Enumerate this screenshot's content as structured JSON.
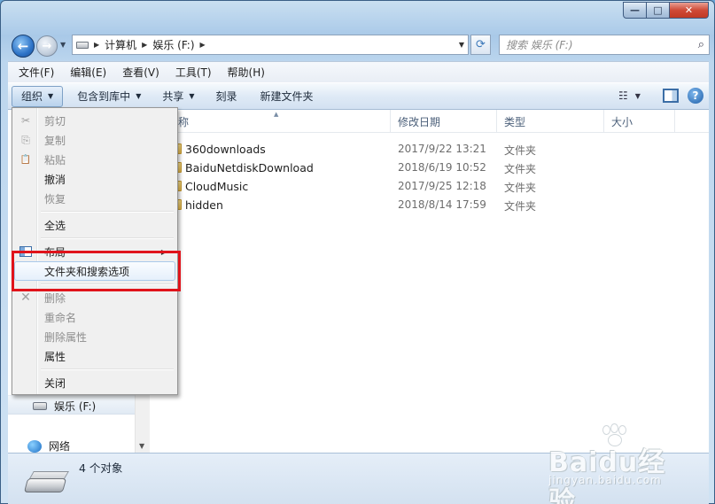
{
  "window": {
    "controls": {
      "minimize": "—",
      "maximize": "□",
      "close": "✕"
    }
  },
  "nav": {
    "back_glyph": "←",
    "forward_glyph": "→",
    "history_glyph": "▼",
    "refresh_glyph": "⟳"
  },
  "address": {
    "crumbs": [
      "计算机",
      "娱乐 (F:)"
    ],
    "separator": "▶",
    "dropdown_glyph": "▼"
  },
  "search": {
    "placeholder": "搜索 娱乐 (F:)",
    "icon_glyph": "⌕"
  },
  "menubar": {
    "items": [
      "文件(F)",
      "编辑(E)",
      "查看(V)",
      "工具(T)",
      "帮助(H)"
    ]
  },
  "toolbar": {
    "organize": "组织",
    "include_library": "包含到库中",
    "share": "共享",
    "burn": "刻录",
    "new_folder": "新建文件夹",
    "arrow_glyph": "▼",
    "views_glyph": "☷",
    "help_glyph": "?"
  },
  "columns": {
    "name": "称",
    "date": "修改日期",
    "type": "类型",
    "size": "大小",
    "sort_glyph": "▲"
  },
  "files": [
    {
      "name": "360downloads",
      "date": "2017/9/22 13:21",
      "type": "文件夹"
    },
    {
      "name": "BaiduNetdiskDownload",
      "date": "2018/6/19 10:52",
      "type": "文件夹"
    },
    {
      "name": "CloudMusic",
      "date": "2017/9/25 12:18",
      "type": "文件夹"
    },
    {
      "name": "hidden",
      "date": "2018/8/14 17:59",
      "type": "文件夹"
    }
  ],
  "navpane": {
    "drive": "娱乐 (F:)",
    "network": "网络",
    "scroll_glyph": "▼"
  },
  "menu": {
    "cut": "剪切",
    "copy": "复制",
    "paste": "粘贴",
    "undo": "撤消",
    "redo": "恢复",
    "select_all": "全选",
    "layout": "布局",
    "folder_options": "文件夹和搜索选项",
    "delete": "删除",
    "rename": "重命名",
    "remove_props": "删除属性",
    "properties": "属性",
    "close": "关闭",
    "submenu_glyph": "▶",
    "cut_glyph": "✂",
    "copy_glyph": "⎘",
    "paste_glyph": "📋",
    "delete_glyph": "✕"
  },
  "status": {
    "count": "4 个对象"
  },
  "watermark": {
    "brand": "Baidu经验",
    "url": "jingyan.baidu.com"
  },
  "colors": {
    "highlight": "#e0131b",
    "accent": "#2e74c8"
  }
}
